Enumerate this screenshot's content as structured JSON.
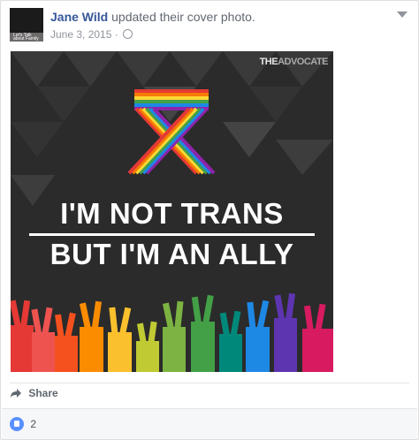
{
  "post": {
    "author": "Jane Wild",
    "action": "updated their cover photo.",
    "date": "June 3, 2015",
    "dot": "·",
    "avatar_text": "Let's Talk about Family"
  },
  "image": {
    "brand_prefix": "THE",
    "brand_name": "ADVOCATE",
    "line1": "I'M NOT TRANS",
    "line2": "BUT I'M AN ALLY"
  },
  "actions": {
    "share_label": "Share"
  },
  "footer": {
    "like_count": "2"
  },
  "colors": {
    "name": "#365899",
    "like_blue": "#5890ff",
    "rainbow": [
      "#e53935",
      "#f57c00",
      "#fdd835",
      "#43a047",
      "#1e88e5",
      "#8e24aa"
    ]
  },
  "icons": [
    "globe-icon",
    "chevron-down-icon",
    "share-icon",
    "like-icon"
  ]
}
